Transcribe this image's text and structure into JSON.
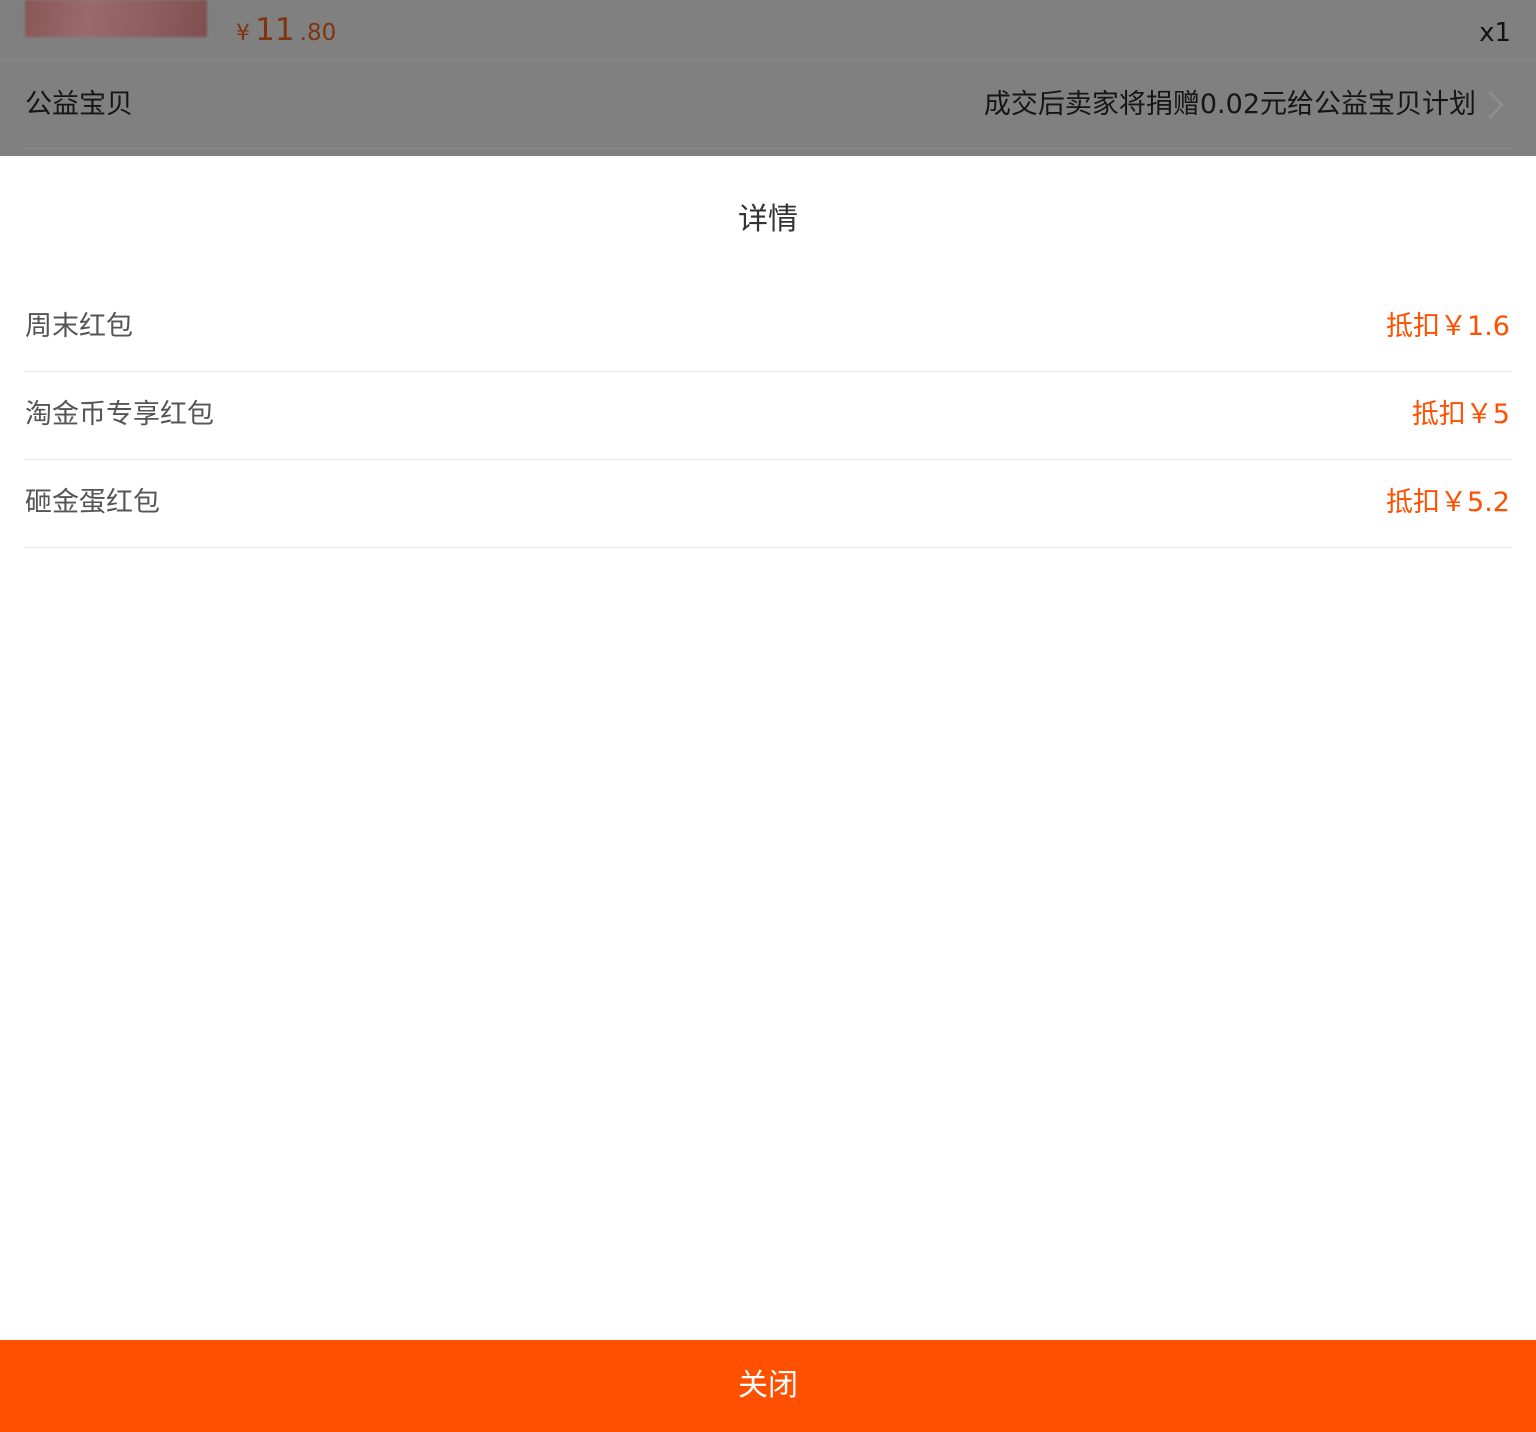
{
  "background": {
    "product": {
      "price_currency": "¥",
      "price_integer": "11",
      "price_decimal": ".80",
      "quantity": "x1"
    },
    "charity": {
      "label": "公益宝贝",
      "description": "成交后卖家将捐赠0.02元给公益宝贝计划"
    }
  },
  "sheet": {
    "title": "详情",
    "items": [
      {
        "label": "周末红包",
        "value": "抵扣￥1.6"
      },
      {
        "label": "淘金币专享红包",
        "value": "抵扣￥5"
      },
      {
        "label": "砸金蛋红包",
        "value": "抵扣￥5.2"
      }
    ],
    "close_label": "关闭"
  },
  "colors": {
    "accent": "#ff5000",
    "overlay": "#808080",
    "label_text": "#555555",
    "title_text": "#333333",
    "divider": "#e6e6e6"
  },
  "icons": {
    "charity_arrow": "chevron-right-icon"
  }
}
